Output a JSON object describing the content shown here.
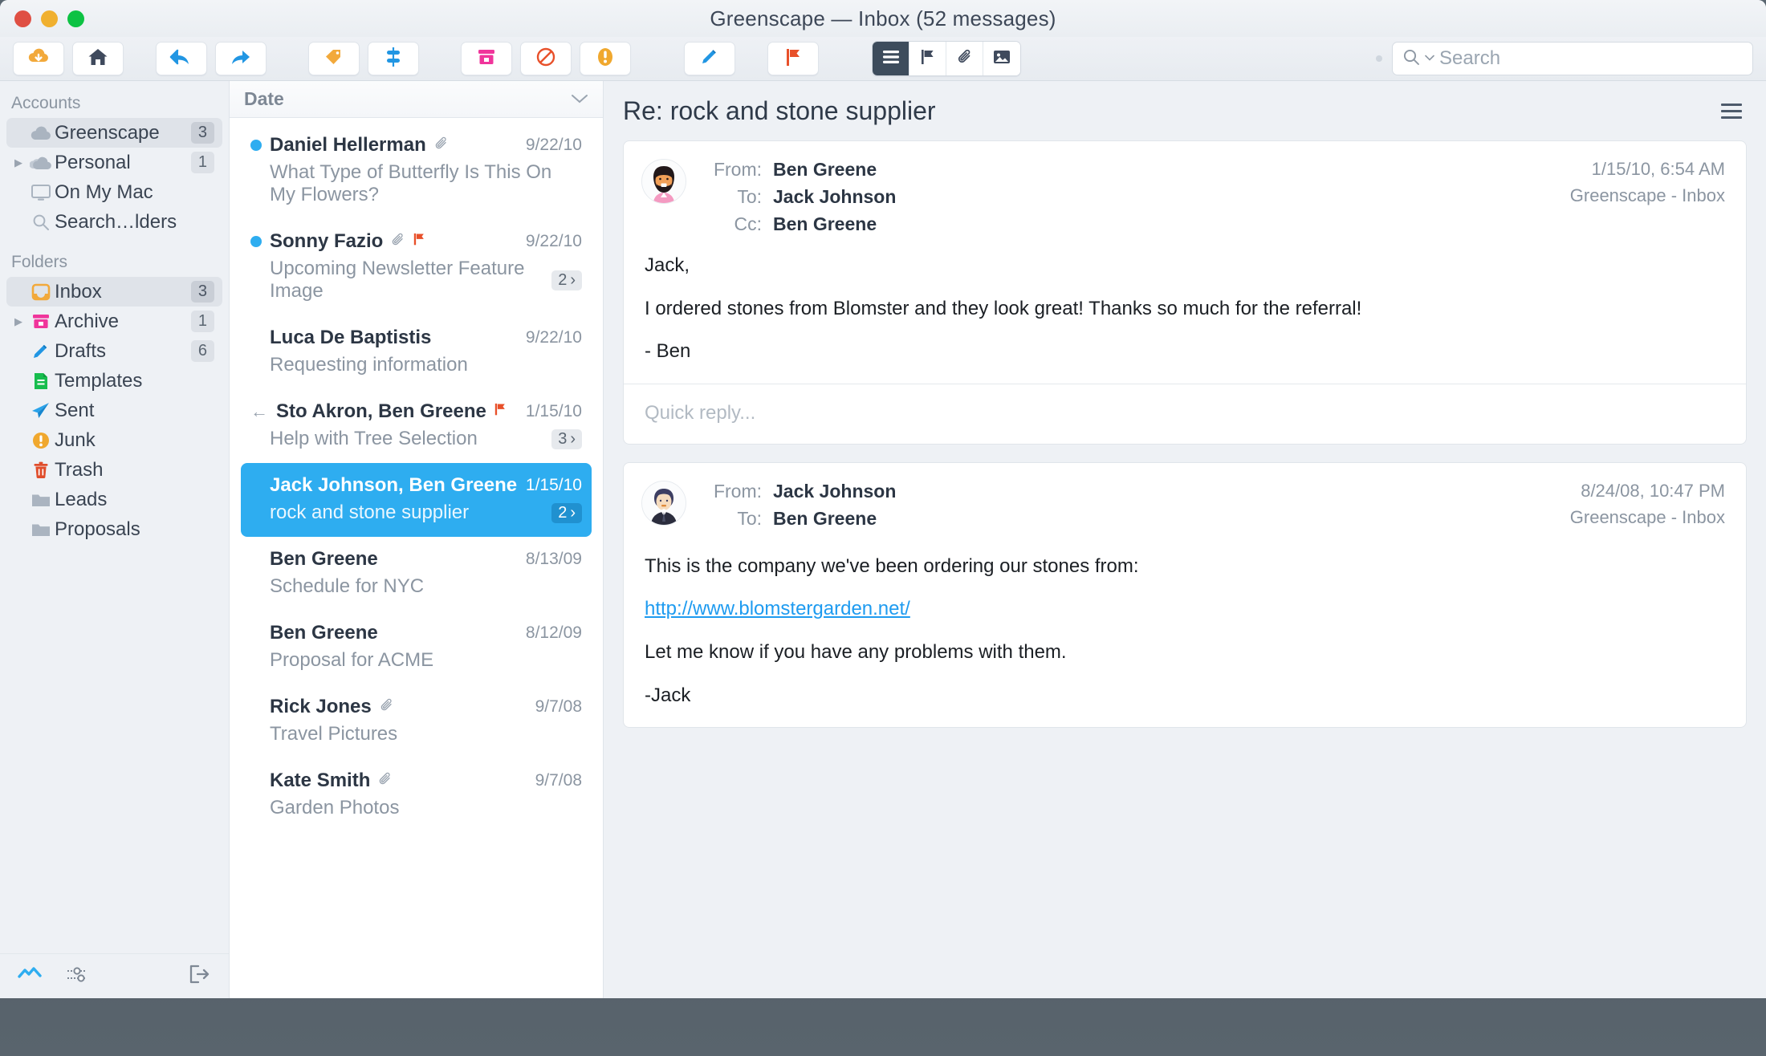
{
  "window": {
    "title": "Greenscape — Inbox (52 messages)",
    "traffic_lights": [
      "close",
      "minimize",
      "maximize"
    ]
  },
  "toolbar": {
    "buttons": [
      {
        "name": "get-mail-button",
        "icon": "cloud-download-icon",
        "label": "Get Mail"
      },
      {
        "name": "home-button",
        "icon": "home-icon",
        "label": "Home"
      },
      {
        "name": "reply-all-button",
        "icon": "reply-all-icon",
        "label": "Reply All"
      },
      {
        "name": "forward-button",
        "icon": "forward-icon",
        "label": "Forward"
      },
      {
        "name": "tag-button",
        "icon": "tag-icon",
        "label": "Tag"
      },
      {
        "name": "filter-button",
        "icon": "filter-icon",
        "label": "Filter"
      },
      {
        "name": "archive-button",
        "icon": "archive-icon",
        "label": "Archive"
      },
      {
        "name": "block-button",
        "icon": "block-icon",
        "label": "Block"
      },
      {
        "name": "junk-button",
        "icon": "junk-icon",
        "label": "Junk"
      },
      {
        "name": "compose-button",
        "icon": "pencil-icon",
        "label": "Compose"
      },
      {
        "name": "flag-button",
        "icon": "flag-icon",
        "label": "Flag"
      }
    ],
    "view_segments": [
      {
        "name": "list-view-toggle",
        "icon": "list-icon",
        "active": true
      },
      {
        "name": "flagged-view-toggle",
        "icon": "flag-icon",
        "active": false
      },
      {
        "name": "attachments-view-toggle",
        "icon": "paperclip-icon",
        "active": false
      },
      {
        "name": "images-view-toggle",
        "icon": "image-icon",
        "active": false
      }
    ]
  },
  "search": {
    "placeholder": "Search",
    "value": "",
    "icon": "search-icon",
    "dropdown_icon": "chevron-down-icon"
  },
  "sidebar": {
    "accounts_header": "Accounts",
    "accounts": [
      {
        "label": "Greenscape",
        "badge": "3",
        "icon": "cloud-icon",
        "selected": true,
        "disclosure": false
      },
      {
        "label": "Personal",
        "badge": "1",
        "icon": "cloud-icon",
        "selected": false,
        "disclosure": true
      },
      {
        "label": "On My Mac",
        "badge": "",
        "icon": "monitor-icon",
        "selected": false,
        "disclosure": false
      },
      {
        "label": "Search…lders",
        "badge": "",
        "icon": "search-icon",
        "selected": false,
        "disclosure": false
      }
    ],
    "folders_header": "Folders",
    "folders": [
      {
        "label": "Inbox",
        "badge": "3",
        "icon": "inbox-icon",
        "selected": true,
        "disclosure": false
      },
      {
        "label": "Archive",
        "badge": "1",
        "icon": "archive-icon",
        "selected": false,
        "disclosure": true
      },
      {
        "label": "Drafts",
        "badge": "6",
        "icon": "pencil-icon",
        "selected": false,
        "disclosure": false
      },
      {
        "label": "Templates",
        "badge": "",
        "icon": "document-icon",
        "selected": false,
        "disclosure": false
      },
      {
        "label": "Sent",
        "badge": "",
        "icon": "paper-plane-icon",
        "selected": false,
        "disclosure": false
      },
      {
        "label": "Junk",
        "badge": "",
        "icon": "junk-icon",
        "selected": false,
        "disclosure": false
      },
      {
        "label": "Trash",
        "badge": "",
        "icon": "trash-icon",
        "selected": false,
        "disclosure": false
      },
      {
        "label": "Leads",
        "badge": "",
        "icon": "folder-icon",
        "selected": false,
        "disclosure": false
      },
      {
        "label": "Proposals",
        "badge": "",
        "icon": "folder-icon",
        "selected": false,
        "disclosure": false
      }
    ],
    "footer_buttons": [
      {
        "name": "activity-button",
        "icon": "activity-icon"
      },
      {
        "name": "settings-button",
        "icon": "sliders-icon"
      },
      {
        "name": "sign-out-button",
        "icon": "logout-icon"
      }
    ]
  },
  "message_list": {
    "sort_label": "Date",
    "sort_chevron": "chevron-down-icon",
    "messages": [
      {
        "from": "Daniel Hellerman",
        "subject": "What Type of Butterfly Is This On My Flowers?",
        "date": "9/22/10",
        "unread": true,
        "attachment": true,
        "flagged": false,
        "replied": false,
        "count": "",
        "selected": false
      },
      {
        "from": "Sonny Fazio",
        "subject": "Upcoming Newsletter Feature Image",
        "date": "9/22/10",
        "unread": true,
        "attachment": true,
        "flagged": true,
        "replied": false,
        "count": "2",
        "selected": false
      },
      {
        "from": "Luca De Baptistis",
        "subject": "Requesting information",
        "date": "9/22/10",
        "unread": false,
        "attachment": false,
        "flagged": false,
        "replied": false,
        "count": "",
        "selected": false
      },
      {
        "from": "Sto Akron, Ben Greene",
        "subject": "Help with Tree Selection",
        "date": "1/15/10",
        "unread": false,
        "attachment": false,
        "flagged": true,
        "replied": true,
        "count": "3",
        "selected": false
      },
      {
        "from": "Jack Johnson, Ben Greene",
        "subject": "rock and stone supplier",
        "date": "1/15/10",
        "unread": false,
        "attachment": false,
        "flagged": false,
        "replied": false,
        "count": "2",
        "selected": true
      },
      {
        "from": "Ben Greene",
        "subject": "Schedule for NYC",
        "date": "8/13/09",
        "unread": false,
        "attachment": false,
        "flagged": false,
        "replied": false,
        "count": "",
        "selected": false
      },
      {
        "from": "Ben Greene",
        "subject": "Proposal for ACME",
        "date": "8/12/09",
        "unread": false,
        "attachment": false,
        "flagged": false,
        "replied": false,
        "count": "",
        "selected": false
      },
      {
        "from": "Rick Jones",
        "subject": "Travel Pictures",
        "date": "9/7/08",
        "unread": false,
        "attachment": true,
        "flagged": false,
        "replied": false,
        "count": "",
        "selected": false
      },
      {
        "from": "Kate Smith",
        "subject": "Garden Photos",
        "date": "9/7/08",
        "unread": false,
        "attachment": true,
        "flagged": false,
        "replied": false,
        "count": "",
        "selected": false
      }
    ]
  },
  "reader": {
    "title": "Re: rock and stone supplier",
    "menu_icon": "hamburger-icon",
    "messages": [
      {
        "avatar": "avatar-ben-greene",
        "from_label": "From:",
        "from": "Ben Greene",
        "to_label": "To:",
        "to": "Jack Johnson",
        "cc_label": "Cc:",
        "cc": "Ben Greene",
        "timestamp": "1/15/10, 6:54 AM",
        "mailbox": "Greenscape - Inbox",
        "body": [
          {
            "type": "text",
            "text": "Jack,"
          },
          {
            "type": "text",
            "text": "I ordered stones from Blomster and they look great!  Thanks so much for the referral!"
          },
          {
            "type": "text",
            "text": "- Ben"
          }
        ],
        "quick_reply_placeholder": "Quick reply...",
        "has_quick_reply": true
      },
      {
        "avatar": "avatar-jack-johnson",
        "from_label": "From:",
        "from": "Jack Johnson",
        "to_label": "To:",
        "to": "Ben Greene",
        "cc_label": "",
        "cc": "",
        "timestamp": "8/24/08, 10:47 PM",
        "mailbox": "Greenscape - Inbox",
        "body": [
          {
            "type": "text",
            "text": "This is the company we've been ordering our stones from:"
          },
          {
            "type": "link",
            "text": "http://www.blomstergarden.net/"
          },
          {
            "type": "text",
            "text": "Let me know if you have any problems with them."
          },
          {
            "type": "text",
            "text": "-Jack"
          }
        ],
        "quick_reply_placeholder": "",
        "has_quick_reply": false
      }
    ]
  },
  "colors": {
    "accent_blue": "#2eadf0",
    "flag_red": "#e8502a",
    "junk_amber": "#f0a82e",
    "archive_pink": "#f0359b",
    "sent_blue": "#1e9bf0",
    "templates_green": "#17bd4e",
    "trash_red": "#e04d2b",
    "sidebar_bg": "#eef1f5"
  }
}
